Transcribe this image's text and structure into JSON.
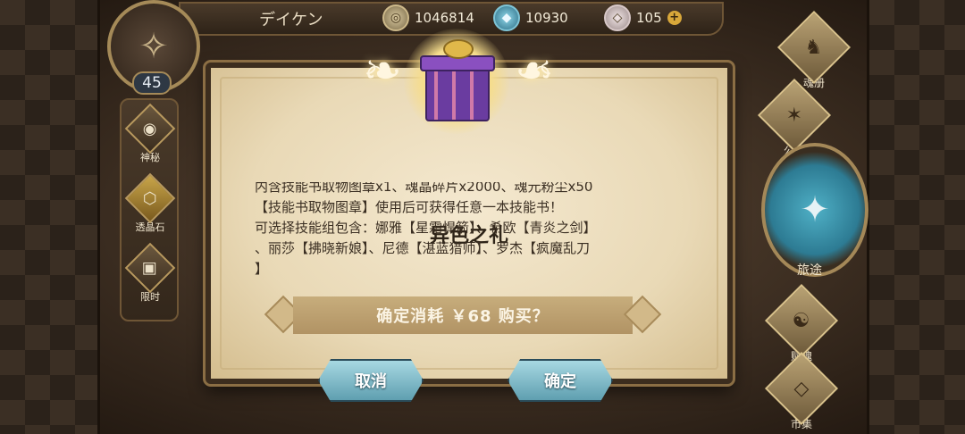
{
  "topbar": {
    "player_name": "デイケン",
    "gold": "1046814",
    "crystal": "10930",
    "gem": "105",
    "plus": "+"
  },
  "player": {
    "level": "45"
  },
  "left_nav": [
    {
      "label": "神秘",
      "icon": "swirl-icon"
    },
    {
      "label": "透晶石",
      "icon": "crystal-icon"
    },
    {
      "label": "限时",
      "icon": "gift-icon"
    }
  ],
  "right_nav": [
    {
      "label": "魂册",
      "icon": "soul-book-icon"
    },
    {
      "label": "公会",
      "icon": "guild-icon"
    },
    {
      "label": "旅途",
      "icon": "journey-icon"
    },
    {
      "label": "赋魂",
      "icon": "soul-icon"
    },
    {
      "label": "市集",
      "icon": "market-icon"
    }
  ],
  "dialog": {
    "title": "异色之礼",
    "desc_line1": "内含技能书取物图章x1、魂晶碎片x2000、魂元粉尘x50",
    "desc_line2": "【技能书取物图章】使用后可获得任意一本技能书！",
    "desc_line3": "可选择技能组包含：娜雅【星霜悍箭】、希欧【青炎之剑】",
    "desc_line4": "、丽莎【拂晓新娘】、尼德【湛蓝猎师】、罗杰【疯魔乱刀",
    "desc_line5": "】",
    "confirm_text": "确定消耗 ￥68 购买？",
    "cancel_label": "取消",
    "ok_label": "确定"
  },
  "colors": {
    "button": "#6fb0c2",
    "parchment": "#efe2c4",
    "frame": "#3c2d1e"
  }
}
